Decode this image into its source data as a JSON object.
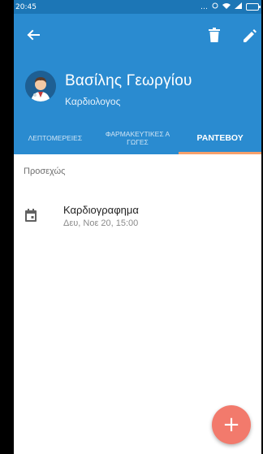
{
  "status_bar": {
    "time": "20:45",
    "icons": [
      "dots-icon",
      "alarm-icon",
      "wifi-icon",
      "signal-icon",
      "battery-icon"
    ]
  },
  "toolbar": {
    "back_icon": "arrow-left-icon",
    "delete_icon": "trash-icon",
    "edit_icon": "pencil-icon"
  },
  "doctor": {
    "name": "Βασίλης Γεωργίου",
    "specialty": "Καρδιολογος",
    "avatar_icon": "doctor-avatar-icon"
  },
  "tabs": [
    {
      "label": "ΛΕΠΤΟΜΕΡΕΙΕΣ",
      "active": false
    },
    {
      "label": "ΦΑΡΜΑΚΕΥΤΙΚΕΣ ΑΓΩΓΕΣ",
      "active": false
    },
    {
      "label": "ΡΑΝΤΕΒΟΥ",
      "active": true
    }
  ],
  "appointments": {
    "section_title": "Προσεχώς",
    "items": [
      {
        "title": "Καρδιογραφημα",
        "datetime": "Δευ, Νοε 20, 15:00",
        "icon": "calendar-icon"
      }
    ]
  },
  "fab": {
    "label": "+"
  },
  "colors": {
    "primary": "#2a8bd0",
    "status_bar": "#1c76b6",
    "tab_indicator": "#f6a06b",
    "fab": "#f27a6c"
  }
}
